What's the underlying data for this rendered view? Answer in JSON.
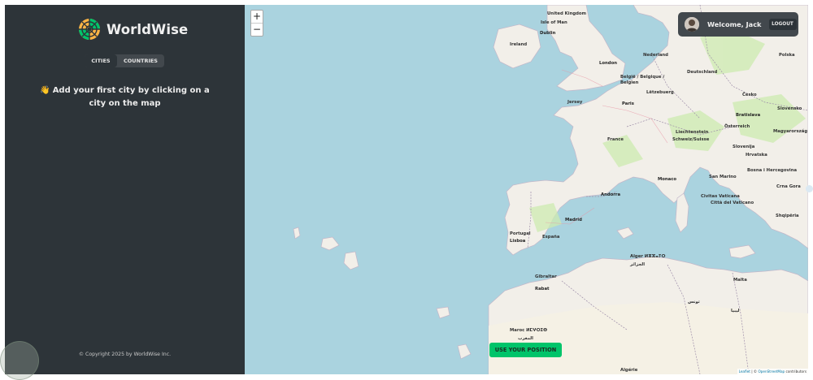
{
  "app": {
    "name": "WorldWise"
  },
  "sidebar": {
    "tabs": [
      {
        "label": "CITIES",
        "active": true
      },
      {
        "label": "COUNTRIES",
        "active": false
      }
    ],
    "empty_message_emoji": "👋",
    "empty_message": "Add your first city by clicking on a city on the map",
    "copyright": "© Copyright 2025 by WorldWise Inc."
  },
  "map": {
    "zoom_in": "+",
    "zoom_out": "−",
    "user": {
      "welcome": "Welcome, Jack",
      "logout": "LOGOUT"
    },
    "use_position_button": "USE YOUR POSITION",
    "attribution": {
      "leaflet": "Leaflet",
      "separator": " | © ",
      "osm": "OpenStreetMap",
      "contributors": " contributors"
    },
    "place_labels": {
      "united_kingdom": "United Kingdom",
      "isle_of_man": "Isle of Man",
      "dublin": "Dublin",
      "ireland": "Ireland",
      "london": "London",
      "nederland": "Nederland",
      "deutschland": "Deutschland",
      "polska": "Polska",
      "belgie": "België / Belgique / Belgien",
      "luxembourg": "Lëtzebuerg",
      "paris": "Paris",
      "jersey": "Jersey",
      "cesko": "Česko",
      "slovensko": "Slovensko",
      "bratislava": "Bratislava",
      "osterreich": "Österreich",
      "magyarorszag": "Magyarország",
      "liechtenstein": "Liechtenstein",
      "schweiz": "Schweiz/Suisse",
      "slovenija": "Slovenija",
      "hrvatska": "Hrvatska",
      "france": "France",
      "monaco": "Monaco",
      "san_marino": "San Marino",
      "bosna": "Bosna i Hercegovina",
      "crna_gora": "Crna Gora",
      "civitas": "Civitas Vaticana",
      "citta": "Città del Vaticano",
      "shqiperia": "Shqipëria",
      "andorra": "Andorra",
      "madrid": "Madrid",
      "espana": "España",
      "portugal": "Portugal",
      "lisboa": "Lisboa",
      "gibraltar": "Gibraltar",
      "rabat": "Rabat",
      "alger": "Alger ⵍⵣⵣⴰⵢⵔ",
      "alger_ar": "الجزائر",
      "tunis": "تونس",
      "malta": "Malta",
      "libya": "ليبيا",
      "maroc": "Maroc ⵍⵎⵖⵔⵉⴱ",
      "maroc_ar": "المغرب",
      "algerie": "Algérie"
    }
  },
  "colors": {
    "sidebar_bg": "#2d3439",
    "panel_bg": "#42484d",
    "accent_green": "#00c46a",
    "sea": "#aad3df",
    "land": "#f2efe9"
  },
  "icons": {
    "logo": "worldwise-logo-icon",
    "avatar": "user-avatar",
    "wave": "waving-hand-emoji"
  }
}
